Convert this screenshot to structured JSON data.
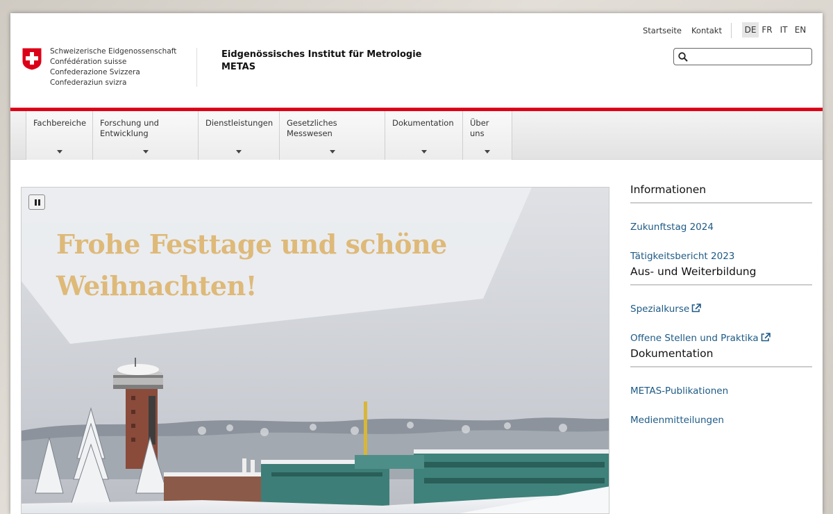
{
  "header": {
    "confederation_lines": [
      "Schweizerische Eidgenossenschaft",
      "Confédération suisse",
      "Confederazione Svizzera",
      "Confederaziun svizra"
    ],
    "institute_name": "Eidgenössisches Institut für Metrologie",
    "institute_abbr": "METAS",
    "meta_links": [
      "Startseite",
      "Kontakt"
    ],
    "languages": [
      "DE",
      "FR",
      "IT",
      "EN"
    ],
    "active_language": "DE",
    "search_value": "",
    "brand_red": "#dc0018"
  },
  "nav": {
    "items": [
      {
        "label": "Fachbereiche"
      },
      {
        "label": "Forschung und\nEntwicklung"
      },
      {
        "label": "Dienstleistungen"
      },
      {
        "label": "Gesetzliches\nMesswesen"
      },
      {
        "label": "Dokumentation"
      },
      {
        "label": "Über uns"
      }
    ]
  },
  "hero": {
    "headline": "Frohe Festtage und schöne\nWeihnachten!",
    "headline_color": "#deb978",
    "image": "snow-covered METAS campus with tower"
  },
  "sidebar": {
    "sections": [
      {
        "title": "Informationen",
        "links": [
          {
            "label": "Zukunftstag 2024",
            "external": false
          },
          {
            "label": "Tätigkeitsbericht 2023",
            "external": false
          }
        ]
      },
      {
        "title": "Aus- und Weiterbildung",
        "links": [
          {
            "label": "Spezialkurse",
            "external": true
          },
          {
            "label": "Offene Stellen und Praktika",
            "external": true
          }
        ]
      },
      {
        "title": "Dokumentation",
        "links": [
          {
            "label": "METAS-Publikationen",
            "external": false
          },
          {
            "label": "Medienmitteilungen",
            "external": false
          }
        ]
      }
    ],
    "link_color": "#1d5a86"
  }
}
